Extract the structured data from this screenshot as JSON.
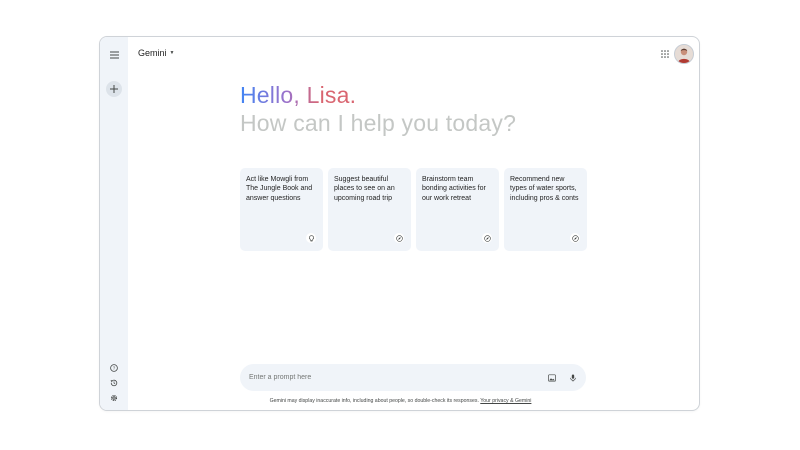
{
  "app": {
    "title": "Gemini"
  },
  "sidebar": {
    "menu_icon": "menu-icon",
    "new_chat_icon": "plus-icon",
    "bottom_icons": [
      "help-icon",
      "history-icon",
      "settings-icon"
    ]
  },
  "header": {
    "apps_icon": "apps-grid-icon",
    "avatar_icon": "user-avatar"
  },
  "greeting": {
    "hello": "Hello, Lisa.",
    "subtitle": "How can I help you today?",
    "gradient_colors": [
      "#4285f4",
      "#9b72cb",
      "#d96570"
    ]
  },
  "suggestions": [
    {
      "text": "Act like Mowgli from The Jungle Book and answer questions",
      "icon": "lightbulb-icon"
    },
    {
      "text": "Suggest beautiful places to see on an upcoming road trip",
      "icon": "compass-icon"
    },
    {
      "text": "Brainstorm team bonding activities for our work retreat",
      "icon": "compass-icon"
    },
    {
      "text": "Recommend new types of water sports, including pros & conts",
      "icon": "compass-icon"
    }
  ],
  "prompt": {
    "placeholder": "Enter a prompt here",
    "value": "",
    "image_icon": "image-upload-icon",
    "mic_icon": "microphone-icon"
  },
  "footer": {
    "disclaimer": "Gemini may display inaccurate info, including about people, so double-check its responses.",
    "privacy_link": "Your privacy & Gemini"
  },
  "colors": {
    "sidebar_bg": "#f0f4f9",
    "card_bg": "#f0f4f9",
    "subtitle": "#c4c7c5",
    "text": "#1f1f1f"
  }
}
